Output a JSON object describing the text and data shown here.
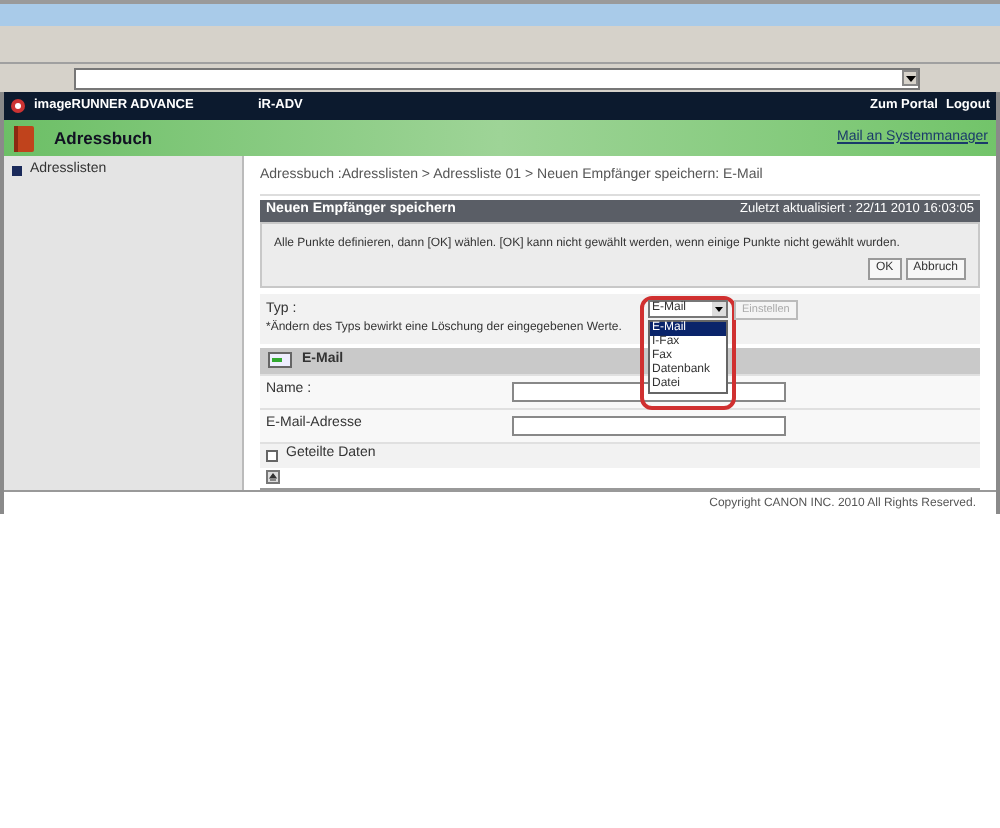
{
  "header": {
    "product": "imageRUNNER ADVANCE",
    "device": "iR-ADV",
    "links": [
      "Zum Portal",
      "Logout"
    ]
  },
  "app_bar": {
    "title": "Adressbuch",
    "link": "Mail an Systemmanager"
  },
  "sidebar": {
    "items": [
      {
        "label": "Adresslisten",
        "selected": false
      }
    ]
  },
  "breadcrumb": "Adressbuch :Adresslisten > Adressliste 01 > Neuen Empfänger speichern: E-Mail",
  "panel": {
    "title": "Neuen Empfänger speichern",
    "updated": "Zuletzt aktualisiert : 22/11 2010 16:03:05",
    "message": "Alle Punkte definieren, dann [OK] wählen. [OK] kann nicht gewählt werden, wenn einige Punkte nicht gewählt wurden.",
    "buttons": [
      "OK",
      "Abbruch"
    ]
  },
  "type_field": {
    "label": "Typ :",
    "note": "*Ändern des Typs bewirkt eine Löschung der eingegebenen Werte.",
    "value": "E-Mail",
    "button": {
      "label": "Einstellen",
      "disabled": true
    },
    "expanded": true,
    "options": [
      {
        "label": "E-Mail",
        "selected": true
      },
      {
        "label": "I-Fax",
        "selected": false
      },
      {
        "label": "Fax",
        "selected": false
      },
      {
        "label": "Datenbank",
        "selected": false
      },
      {
        "label": "Datei",
        "selected": false
      }
    ]
  },
  "section": {
    "title": "E-Mail",
    "fields": [
      {
        "label": "Name :"
      },
      {
        "label": "E-Mail-Adresse"
      }
    ],
    "checkbox": {
      "label": "Geteilte Daten",
      "checked": false
    }
  },
  "footer": "Copyright CANON INC. 2010 All Rights Reserved."
}
